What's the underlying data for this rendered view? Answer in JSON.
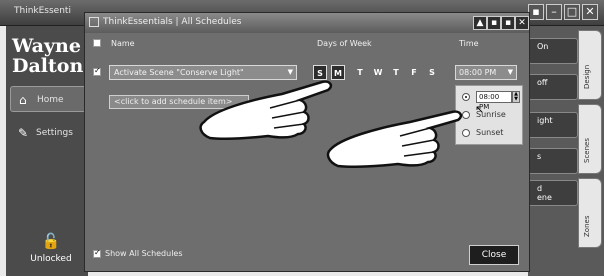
{
  "background_window": {
    "title": "ThinkEssenti",
    "controls": [
      "▪",
      "–",
      "□",
      "✕"
    ],
    "brand": {
      "line1": "Wayne",
      "line2": "Dalton"
    },
    "nav": [
      {
        "label": "Home",
        "icon": "home-icon"
      },
      {
        "label": "Settings",
        "icon": "wrench-icon"
      }
    ],
    "lock_label": "Unlocked",
    "right_panel_buttons": [
      "On",
      "off",
      "ight",
      "s",
      "d\nene"
    ],
    "right_tabs": [
      "Design",
      "Scenes",
      "Zones"
    ]
  },
  "dialog": {
    "title": "ThinkEssentials | All Schedules",
    "controls": [
      "▲",
      "▪",
      "▪",
      "✕"
    ],
    "columns": {
      "name": "Name",
      "days": "Days of Week",
      "time": "Time"
    },
    "row": {
      "checked": true,
      "scene": "Activate Scene \"Conserve Light\"",
      "days": [
        {
          "label": "S",
          "selected": true
        },
        {
          "label": "M",
          "selected": true
        },
        {
          "label": "T",
          "selected": false
        },
        {
          "label": "W",
          "selected": false
        },
        {
          "label": "T",
          "selected": false
        },
        {
          "label": "F",
          "selected": false
        },
        {
          "label": "S",
          "selected": false
        }
      ],
      "time": "08:00 PM"
    },
    "add_schedule_placeholder": "<click to add schedule item>",
    "time_popup": {
      "time_value": "08:00 PM",
      "options": [
        {
          "label": "",
          "selected": true
        },
        {
          "label": "Sunrise",
          "selected": false
        },
        {
          "label": "Sunset",
          "selected": false
        }
      ]
    },
    "footer": {
      "show_all_label": "Show All Schedules",
      "show_all_checked": true,
      "close_label": "Close"
    }
  },
  "colors": {
    "dialog_bg": "#6e6e6e",
    "titlebar": "#5c5c5c",
    "selected_day": "#2c2c2c",
    "popup_bg": "#e2e2e2"
  }
}
